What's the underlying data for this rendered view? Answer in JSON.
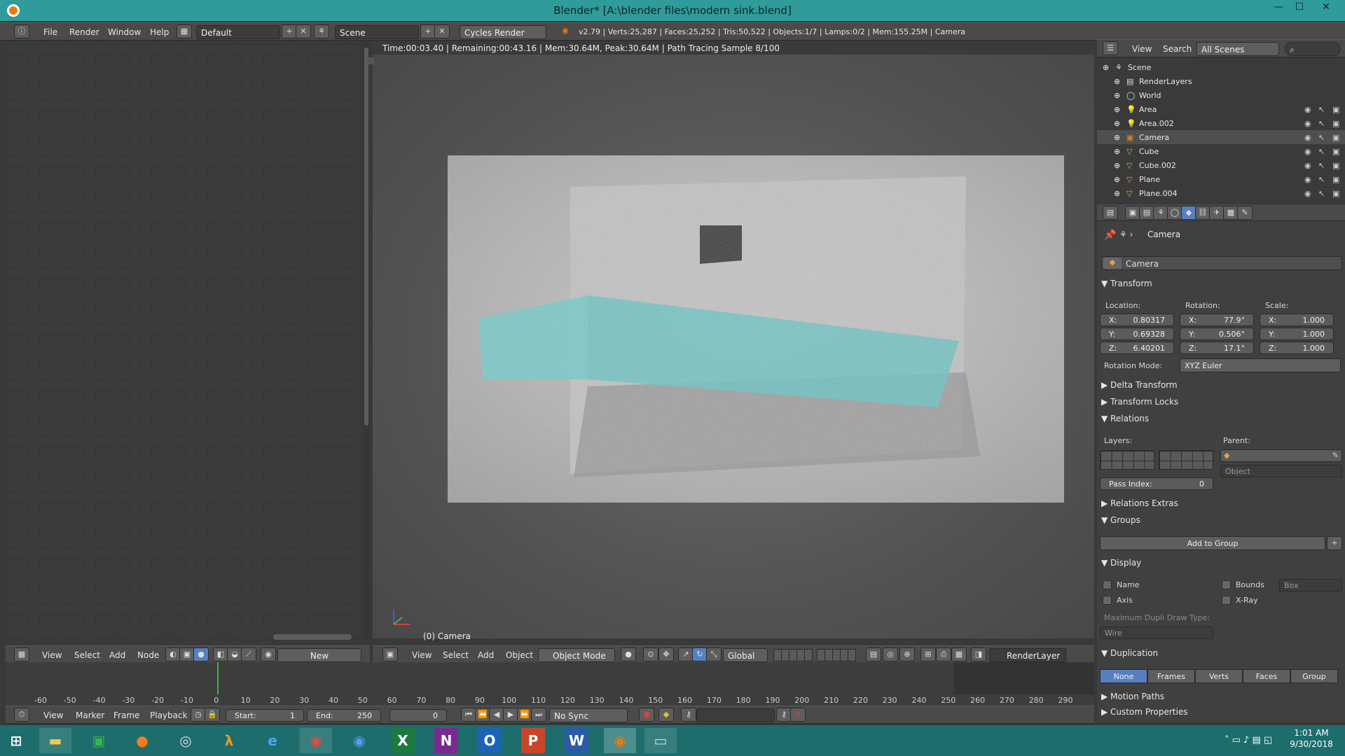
{
  "window": {
    "title": "Blender* [A:\\blender files\\modern sink.blend]"
  },
  "topbar": {
    "menus": [
      "File",
      "Render",
      "Window",
      "Help"
    ],
    "layout": "Default",
    "scene": "Scene",
    "engine": "Cycles Render",
    "stats": "v2.79 | Verts:25,287 | Faces:25,252 | Tris:50,522 | Objects:1/7 | Lamps:0/2 | Mem:155.25M | Camera"
  },
  "viewport": {
    "info": "Time:00:03.40 | Remaining:00:43.16 | Mem:30.64M, Peak:30.64M | Path Tracing Sample 8/100",
    "label": "(0) Camera",
    "menus": [
      "View",
      "Select",
      "Add",
      "Object"
    ],
    "mode": "Object Mode",
    "orientation": "Global",
    "layer": "RenderLayer"
  },
  "node_editor": {
    "menus": [
      "View",
      "Select",
      "Add",
      "Node"
    ],
    "new_label": "New"
  },
  "outliner": {
    "menus": [
      "View",
      "Search"
    ],
    "filter": "All Scenes",
    "items": [
      {
        "label": "Scene",
        "icon": "scene-icon",
        "indent": 0
      },
      {
        "label": "RenderLayers",
        "icon": "renderlayers-icon",
        "indent": 1
      },
      {
        "label": "World",
        "icon": "world-icon",
        "indent": 1
      },
      {
        "label": "Area",
        "icon": "lamp-icon",
        "indent": 1
      },
      {
        "label": "Area.002",
        "icon": "lamp-icon",
        "indent": 1
      },
      {
        "label": "Camera",
        "icon": "camera-icon",
        "indent": 1
      },
      {
        "label": "Cube",
        "icon": "mesh-icon",
        "indent": 1
      },
      {
        "label": "Cube.002",
        "icon": "mesh-icon",
        "indent": 1
      },
      {
        "label": "Plane",
        "icon": "mesh-icon",
        "indent": 1
      },
      {
        "label": "Plane.004",
        "icon": "mesh-icon",
        "indent": 1
      }
    ]
  },
  "properties": {
    "breadcrumb": "Camera",
    "object_name": "Camera",
    "transform": {
      "header": "Transform",
      "location_label": "Location:",
      "rotation_label": "Rotation:",
      "scale_label": "Scale:",
      "location": [
        {
          "axis": "X:",
          "value": "0.80317"
        },
        {
          "axis": "Y:",
          "value": "0.69328"
        },
        {
          "axis": "Z:",
          "value": "6.40201"
        }
      ],
      "rotation": [
        {
          "axis": "X:",
          "value": "77.9°"
        },
        {
          "axis": "Y:",
          "value": "0.506°"
        },
        {
          "axis": "Z:",
          "value": "17.1°"
        }
      ],
      "scale": [
        {
          "axis": "X:",
          "value": "1.000"
        },
        {
          "axis": "Y:",
          "value": "1.000"
        },
        {
          "axis": "Z:",
          "value": "1.000"
        }
      ],
      "rotation_mode_label": "Rotation Mode:",
      "rotation_mode": "XYZ Euler"
    },
    "delta_transform": "Delta Transform",
    "transform_locks": "Transform Locks",
    "relations": {
      "header": "Relations",
      "layers_label": "Layers:",
      "parent_label": "Parent:",
      "parent_type": "Object",
      "pass_index_label": "Pass Index:",
      "pass_index": "0"
    },
    "relations_extras": "Relations Extras",
    "groups": {
      "header": "Groups",
      "add_button": "Add to Group"
    },
    "display": {
      "header": "Display",
      "name": "Name",
      "bounds": "Bounds",
      "bounds_type": "Box",
      "axis": "Axis",
      "xray": "X-Ray",
      "dupli_label": "Maximum Dupli Draw Type:",
      "dupli_value": "Wire"
    },
    "duplication": {
      "header": "Duplication",
      "options": [
        "None",
        "Frames",
        "Verts",
        "Faces",
        "Group"
      ],
      "active": "None"
    },
    "motion_paths": "Motion Paths",
    "custom_properties": "Custom Properties"
  },
  "timeline": {
    "ticks": [
      "-60",
      "-50",
      "-40",
      "-30",
      "-20",
      "-10",
      "0",
      "10",
      "20",
      "30",
      "40",
      "50",
      "60",
      "70",
      "80",
      "90",
      "100",
      "110",
      "120",
      "130",
      "140",
      "150",
      "160",
      "170",
      "180",
      "190",
      "200",
      "210",
      "220",
      "230",
      "240",
      "250",
      "260",
      "270",
      "280",
      "290"
    ],
    "current_frame": 0,
    "menus": [
      "View",
      "Marker",
      "Frame",
      "Playback"
    ],
    "start_label": "Start:",
    "start": "1",
    "end_label": "End:",
    "end": "250",
    "frame": "0",
    "sync": "No Sync"
  },
  "taskbar": {
    "time": "1:01 AM",
    "date": "9/30/2018"
  },
  "colors": {
    "titlebar": "#2f9b9b",
    "taskbar": "#1d6d6d",
    "active_blue": "#5680c2",
    "water": "#5fc5c5"
  }
}
